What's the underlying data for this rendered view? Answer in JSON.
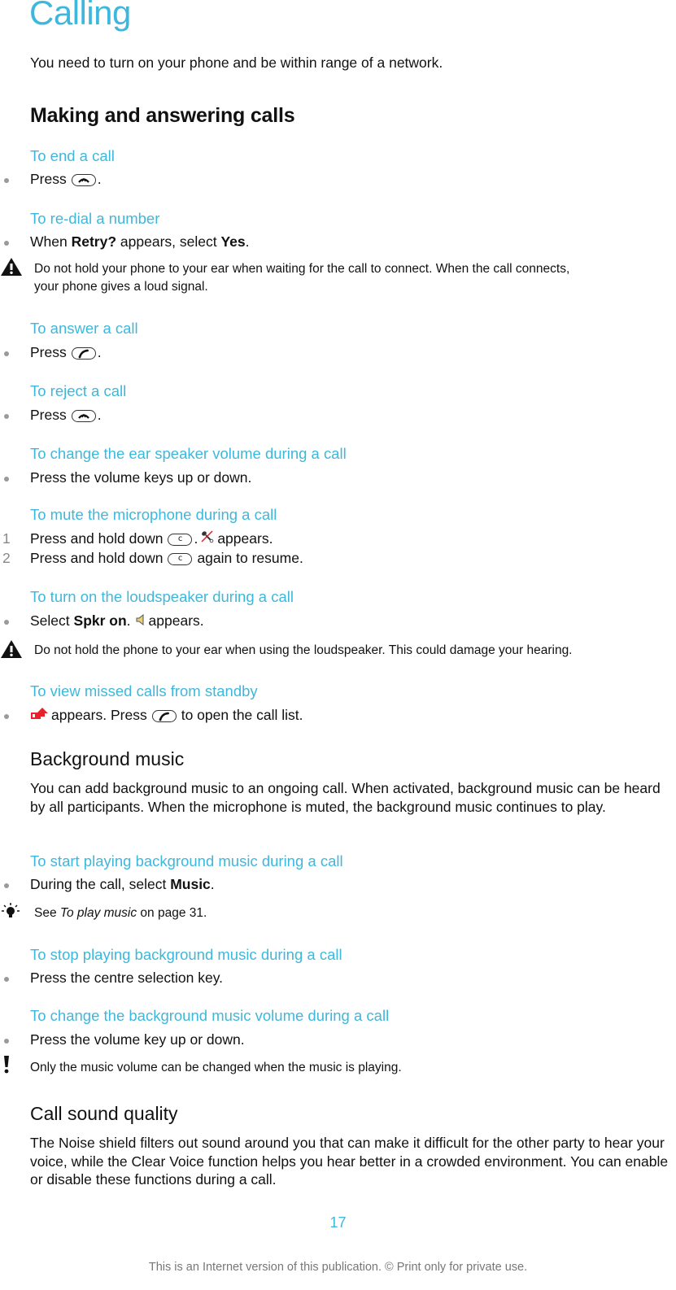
{
  "page": {
    "title": "Calling",
    "intro": "You need to turn on your phone and be within range of a network.",
    "page_number": "17",
    "footer": "This is an Internet version of this publication. © Print only for private use."
  },
  "colors": {
    "accent": "#3db8dc",
    "text": "#111111",
    "bullet": "#9a9a9a",
    "footer": "#777777"
  },
  "sections": {
    "making_calls": {
      "heading": "Making and answering calls",
      "end_call": {
        "title": "To end a call",
        "step_prefix": "Press",
        "step_icon": "end-call-key-icon",
        "step_suffix": "."
      },
      "redial": {
        "title": "To re-dial a number",
        "step_part1": "When",
        "step_bold1": "Retry?",
        "step_part2": "appears, select",
        "step_bold2": "Yes",
        "step_suffix": ".",
        "warning_icon": "warning-icon",
        "warning_line1": "Do not hold your phone to your ear when waiting for the call to connect. When the call connects,",
        "warning_line2": "your phone gives a loud signal."
      },
      "answer": {
        "title": "To answer a call",
        "step_prefix": "Press",
        "step_icon": "call-key-icon",
        "step_suffix": "."
      },
      "reject": {
        "title": "To reject a call",
        "step_prefix": "Press",
        "step_icon": "end-call-key-icon",
        "step_suffix": "."
      },
      "ear_volume": {
        "title": "To change the ear speaker volume during a call",
        "step": "Press the volume keys up or down."
      },
      "mute": {
        "title": "To mute the microphone during a call",
        "steps": [
          {
            "number": "1",
            "prefix": "Press and hold down",
            "key_label": "c",
            "middle": ".",
            "icon": "microphone-muted-icon",
            "suffix": "appears."
          },
          {
            "number": "2",
            "prefix": "Press and hold down",
            "key_label": "c",
            "suffix": "again to resume."
          }
        ]
      },
      "loudspeaker": {
        "title": "To turn on the loudspeaker during a call",
        "step_prefix": "Select",
        "step_bold": "Spkr on",
        "step_middle": ".",
        "step_icon": "loudspeaker-icon",
        "step_suffix": "appears.",
        "warning_icon": "warning-icon",
        "warning": "Do not hold the phone to your ear when using the loudspeaker. This could damage your hearing."
      },
      "missed_calls": {
        "title": "To view missed calls from standby",
        "step_icon": "missed-call-icon",
        "step_part1": "appears. Press",
        "step_key_icon": "call-key-icon",
        "step_part2": "to open the call list."
      }
    },
    "background_music": {
      "heading": "Background music",
      "body": "You can add background music to an ongoing call. When activated, background music can be heard by all participants. When the microphone is muted, the background music continues to play.",
      "start": {
        "title": "To start playing background music during a call",
        "step_prefix": "During the call, select",
        "step_bold": "Music",
        "step_suffix": ".",
        "tip_icon": "tip-lightbulb-icon",
        "tip_prefix": "See",
        "tip_italic": "To play music",
        "tip_suffix": "on page 31."
      },
      "stop": {
        "title": "To stop playing background music during a call",
        "step": "Press the centre selection key."
      },
      "volume": {
        "title": "To change the background music volume during a call",
        "step": "Press the volume key up or down.",
        "note_icon": "note-exclamation-icon",
        "note": "Only the music volume can be changed when the music is playing."
      }
    },
    "call_sound_quality": {
      "heading": "Call sound quality",
      "body": "The Noise shield filters out sound around you that can make it difficult for the other party to hear your voice, while the Clear Voice function helps you hear better in a crowded environment. You can enable or disable these functions during a call."
    }
  }
}
